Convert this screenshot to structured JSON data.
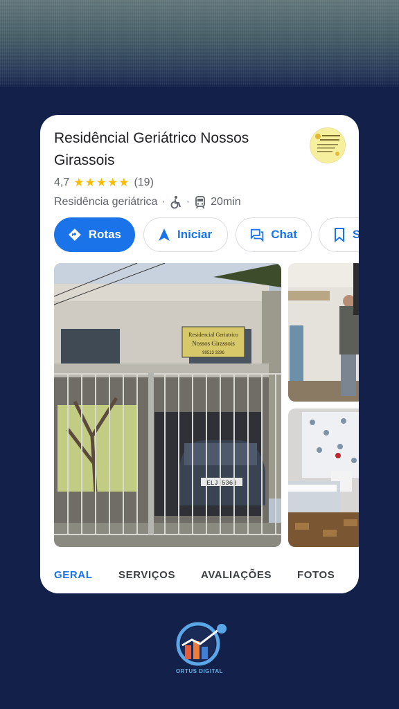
{
  "place": {
    "name": "Residêncial Geriátrico Nossos Girassois",
    "rating": "4,7",
    "stars": "★★★★★",
    "review_count": "(19)",
    "category": "Residência geriátrica",
    "separator": "·",
    "travel_time": "20min"
  },
  "actions": [
    {
      "label": "Rotas",
      "icon": "directions-icon"
    },
    {
      "label": "Iniciar",
      "icon": "navigation-arrow-icon"
    },
    {
      "label": "Chat",
      "icon": "chat-icon"
    },
    {
      "label": "S",
      "icon": "bookmark-icon"
    }
  ],
  "photo_sign": {
    "line1": "Residencial Geriatrico",
    "line2": "Nossos Girassois",
    "phone": "99513 3296"
  },
  "car_plate": "ELJ 5363",
  "tabs": [
    "GERAL",
    "SERVIÇOS",
    "AVALIAÇÕES",
    "FOTOS"
  ],
  "active_tab": "GERAL",
  "brand": "ORTUS DIGITAL",
  "colors": {
    "accent": "#1a73e8",
    "star": "#fbbc04",
    "page_bg": "#13214a",
    "brand_text": "#66aee8"
  }
}
